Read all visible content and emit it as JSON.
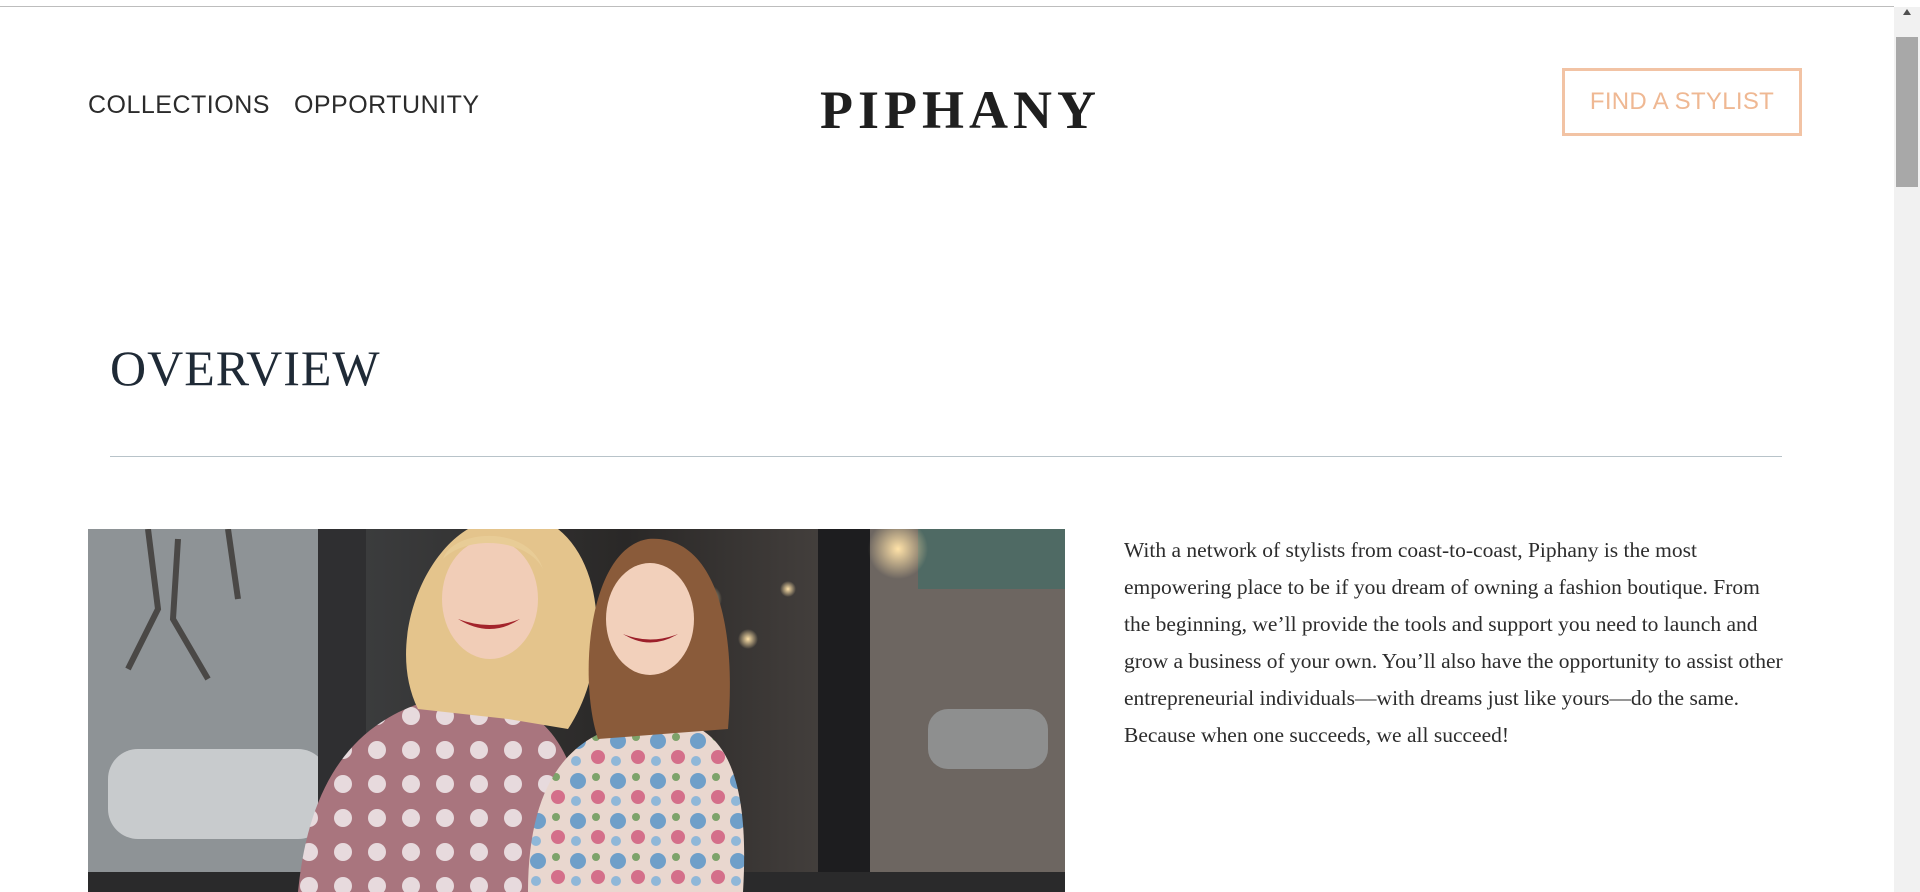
{
  "header": {
    "nav": [
      {
        "label": "COLLECTIONS"
      },
      {
        "label": "OPPORTUNITY"
      }
    ],
    "logo": "PIPHANY",
    "cta_label": "FIND A STYLIST"
  },
  "overview": {
    "title": "OVERVIEW",
    "paragraph": "With a network of stylists from coast-to-coast, Piphany is the most empowering place to be if you dream of owning a fashion boutique. From the beginning, we’ll provide the tools and support you need to launch and grow a business of your own. You’ll also have the opportunity to assist other entrepreneurial individuals—with dreams just like yours—do the same. Because when one succeeds, we all succeed!"
  },
  "colors": {
    "accent": "#efb893",
    "text_dark": "#1f2a36",
    "divider": "#b8c3c9"
  }
}
